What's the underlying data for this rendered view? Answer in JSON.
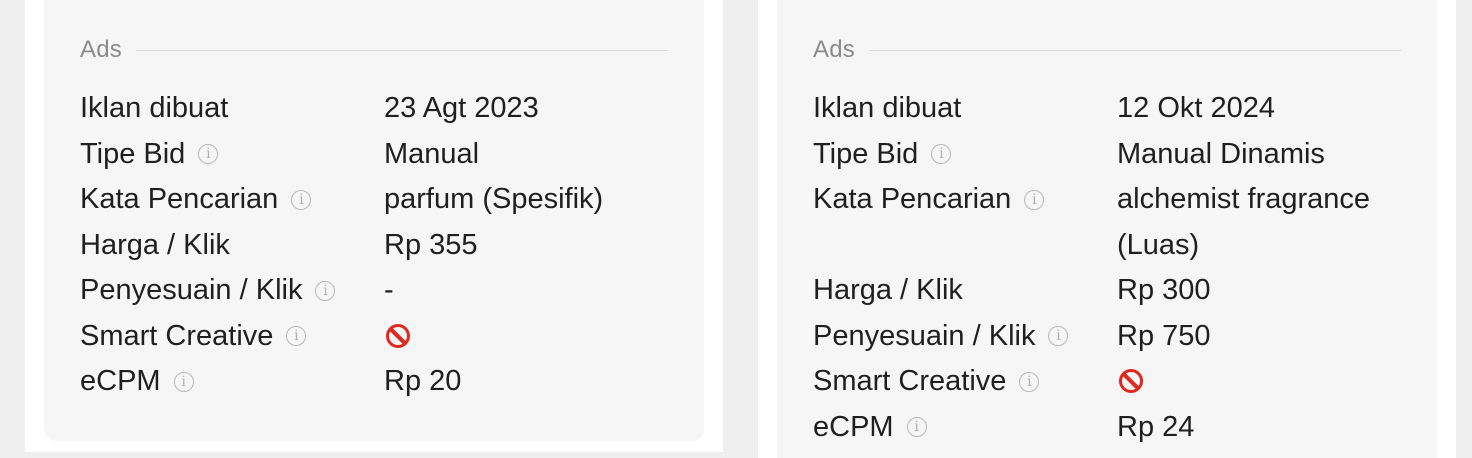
{
  "cards": [
    {
      "section_title": "Ads",
      "rows": [
        {
          "label": "Iklan dibuat",
          "value": "23 Agt 2023",
          "info": false
        },
        {
          "label": "Tipe Bid",
          "value": "Manual",
          "info": true
        },
        {
          "label": "Kata Pencarian",
          "value": "parfum (Spesifik)",
          "info": true
        },
        {
          "label": "Harga / Klik",
          "value": "Rp 355",
          "info": false
        },
        {
          "label": "Penyesuain / Klik",
          "value": "-",
          "info": true
        },
        {
          "label": "Smart Creative",
          "value_icon": "prohibited-icon",
          "info": true
        },
        {
          "label": "eCPM",
          "value": "Rp 20",
          "info": true
        }
      ]
    },
    {
      "section_title": "Ads",
      "rows": [
        {
          "label": "Iklan dibuat",
          "value": "12 Okt 2024",
          "info": false
        },
        {
          "label": "Tipe Bid",
          "value": "Manual Dinamis",
          "info": true
        },
        {
          "label": "Kata Pencarian",
          "value": "alchemist fragrance (Luas)",
          "info": true
        },
        {
          "label": "Harga / Klik",
          "value": "Rp 300",
          "info": false
        },
        {
          "label": "Penyesuain / Klik",
          "value": "Rp 750",
          "info": true
        },
        {
          "label": "Smart Creative",
          "value_icon": "prohibited-icon",
          "info": true
        },
        {
          "label": "eCPM",
          "value": "Rp 24",
          "info": true
        }
      ]
    }
  ],
  "icons": {
    "info": "info-icon",
    "prohibited": "prohibited-icon"
  },
  "colors": {
    "prohibited": "#e0281e",
    "muted": "#8b8b8b"
  }
}
